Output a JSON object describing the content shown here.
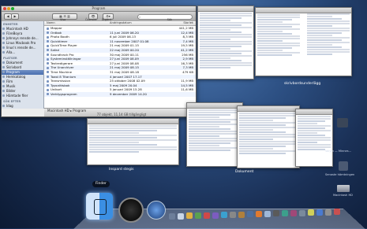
{
  "finder": {
    "title": "Program",
    "tools": {
      "view_label": "Visa",
      "quicklook_label": "Översikt",
      "action_label": "Åtgärd",
      "search_label": "Sök"
    },
    "sidebar": {
      "sections": [
        {
          "title": "ENHETER",
          "items": [
            "Macintosh HD",
            "FöreBoyra",
            "Johnnys rensde de...",
            "Linus Macbook Pro",
            "linus's rensde de...",
            "Alla..."
          ]
        },
        {
          "title": "PLATSER",
          "items": [
            "Dokument",
            "Skrivbord",
            "Program",
            "Hemkatalog",
            "Film",
            "Musik",
            "Bilder",
            "Hämtade filer"
          ]
        },
        {
          "title": "SÖK EFTER",
          "items": [
            "Idag",
            "Igår",
            "Förra veckan"
          ]
        }
      ],
      "selected": "Program"
    },
    "columns": {
      "name": "Namn",
      "modified": "Ändringsdatum",
      "size": "Storlek"
    },
    "rows": [
      {
        "name": "Mappar",
        "modified": "",
        "size": "441,2 MB"
      },
      {
        "name": "Ordbok",
        "modified": "11 juni 2009 06.20",
        "size": "12,4 MB"
      },
      {
        "name": "Photo Booth",
        "modified": "6 juli 2009 06.13",
        "size": "8,3 MB"
      },
      {
        "name": "Quicktimer",
        "modified": "11 november 2007 01.08",
        "size": "7,4 MB"
      },
      {
        "name": "QuickTime Player",
        "modified": "21 maj 2009 01.15",
        "size": "19,5 MB"
      },
      {
        "name": "Safari",
        "modified": "22 maj 2009 00.20",
        "size": "41,2 MB"
      },
      {
        "name": "Soundtrack Pro",
        "modified": "30 maj 2009 00.11",
        "size": "256 MB"
      },
      {
        "name": "Systeminställningar",
        "modified": "27 juni 2009 08.09",
        "size": "2,9 MB"
      },
      {
        "name": "Textredigerare",
        "modified": "27 juni 2009 08.08",
        "size": "16,3 MB"
      },
      {
        "name": "The Unarchiver",
        "modified": "21 maj 2009 08.15",
        "size": "7,3 MB"
      },
      {
        "name": "Time Machine",
        "modified": "31 maj 2009 08.18",
        "size": "479 KB"
      },
      {
        "name": "Toast 8 Titanium",
        "modified": "4 januari 2007 17.17",
        "size": ""
      },
      {
        "name": "Transmission",
        "modified": "25 oktober 2008 02.09",
        "size": "11,9 MB"
      },
      {
        "name": "Typsnittsbok",
        "modified": "5 maj 2009 20.04",
        "size": "14,5 MB"
      },
      {
        "name": "Unikort",
        "modified": "5 januari 2009 15.28",
        "size": "11,6 MB"
      },
      {
        "name": "Verktygsprogram",
        "modified": "9 december 2009 14.20",
        "size": ""
      }
    ],
    "path": "Macintosh HD ▸ Program",
    "status": "77 objekt, 11,14 GB tillgängligt"
  },
  "labels": {
    "desktop_folder": "skrivbordsunderlägg",
    "nedlagda": "Inspard stegis",
    "dokument": "Dokument",
    "dock_tooltip": "Finder",
    "dock_item_finder": "Finder",
    "dock_item_spaces": "Spaces"
  },
  "icons": {
    "desktop_right": [
      "Volym — Minnes...",
      "Senaste hämtningen",
      "Macintosh HD"
    ]
  }
}
